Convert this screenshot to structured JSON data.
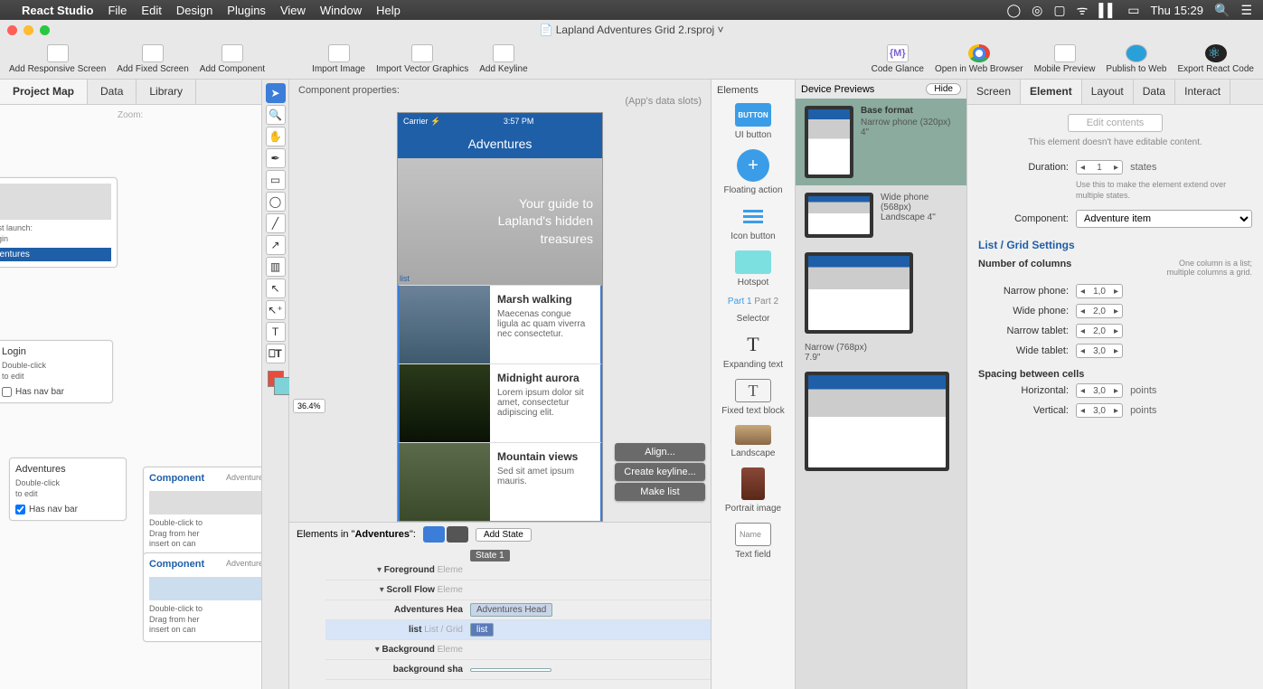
{
  "menubar": {
    "app": "React Studio",
    "items": [
      "File",
      "Edit",
      "Design",
      "Plugins",
      "View",
      "Window",
      "Help"
    ],
    "clock": "Thu 15:29"
  },
  "window": {
    "title": "Lapland Adventures Grid 2.rsproj"
  },
  "toolbar": {
    "left": [
      "Add Responsive Screen",
      "Add Fixed Screen",
      "Add Component"
    ],
    "mid": [
      "Import Image",
      "Import Vector Graphics",
      "Add Keyline"
    ],
    "right": [
      "Code Glance",
      "Open in Web Browser",
      "Mobile Preview",
      "Publish to Web",
      "Export React Code"
    ]
  },
  "left_tabs": [
    "Project Map",
    "Data",
    "Library"
  ],
  "project_map": {
    "zoom_label": "Zoom:",
    "head_card": {
      "first_launch": "First launch:",
      "first_launch_val": "Login",
      "sub": "dventures"
    },
    "login": {
      "title": "Login",
      "sub": "Double-click\nto edit",
      "nav_label": "Has nav bar",
      "nav_checked": false
    },
    "adventures": {
      "title": "Adventures",
      "sub": "Double-click\nto edit",
      "nav_label": "Has nav bar",
      "nav_checked": true
    },
    "comp1": {
      "title": "Component",
      "tag": "Adventure",
      "sub": "Double-click to\nDrag from her\ninsert on can"
    },
    "comp2": {
      "title": "Component",
      "tag": "Adventure",
      "sub": "Double-click to\nDrag from her\ninsert on can"
    }
  },
  "canvas": {
    "props_label": "Component properties:",
    "props_sub": "(App's data slots)",
    "zoom": "36.4%",
    "phone": {
      "carrier": "Carrier ⚡",
      "time": "3:57 PM",
      "navbar": "Adventures",
      "hero_text": "Your guide to Lapland's hidden treasures",
      "hero_label": "list",
      "items": [
        {
          "title": "Marsh walking",
          "body": "Maecenas congue ligula ac quam viverra nec consectetur."
        },
        {
          "title": "Midnight aurora",
          "body": "Lorem ipsum dolor sit amet, consectetur adipiscing elit."
        },
        {
          "title": "Mountain views",
          "body": "Sed sit amet ipsum mauris."
        }
      ]
    },
    "context_menu": [
      "Align...",
      "Create keyline...",
      "Make list"
    ]
  },
  "timeline": {
    "title_prefix": "Elements in \"",
    "title_screen": "Adventures",
    "title_suffix": "\":",
    "add_state": "Add State",
    "state": "State 1",
    "rows": [
      {
        "label": "Foreground",
        "hint": "Eleme"
      },
      {
        "label": "Scroll Flow",
        "hint": "Eleme"
      },
      {
        "label": "Adventures Hea",
        "bar": "Adventures Head"
      },
      {
        "label": "list",
        "hint": "List / Grid",
        "bar": "list"
      },
      {
        "label": "Background",
        "hint": "Eleme"
      },
      {
        "label": "background sha",
        "bar": " "
      }
    ]
  },
  "elements_panel": {
    "heading": "Elements",
    "items": [
      "UI button",
      "Floating action",
      "Icon button",
      "Hotspot",
      "Selector",
      "Expanding text",
      "Fixed text block",
      "Landscape",
      "Portrait image",
      "Text field"
    ],
    "button_badge": "BUTTON",
    "part1": "Part 1",
    "part2": "Part 2",
    "name_placeholder": "Name"
  },
  "previews": {
    "heading": "Device Previews",
    "hide": "Hide",
    "devices": [
      {
        "title": "Base format",
        "sub1": "Narrow phone (320px)",
        "sub2": "4\""
      },
      {
        "title": "",
        "sub1": "Wide phone (568px)",
        "sub2": "Landscape 4\""
      },
      {
        "title": "",
        "sub1": "Narrow (768px)",
        "sub2": "7.9\""
      },
      {
        "title": "",
        "sub1": "",
        "sub2": ""
      }
    ]
  },
  "inspector": {
    "tabs": [
      "Screen",
      "Element",
      "Layout",
      "Data",
      "Interact"
    ],
    "active_tab": "Element",
    "edit_contents": "Edit contents",
    "no_edit_note": "This element doesn't have editable content.",
    "duration_label": "Duration:",
    "duration_val": "1",
    "duration_unit": "states",
    "duration_help": "Use this to make the element extend over multiple states.",
    "component_label": "Component:",
    "component_val": "Adventure item",
    "section": "List / Grid Settings",
    "num_cols_label": "Number of columns",
    "cols_help": "One column is a list;\nmultiple columns a grid.",
    "rows": [
      {
        "label": "Narrow phone:",
        "val": "1,0"
      },
      {
        "label": "Wide phone:",
        "val": "2,0"
      },
      {
        "label": "Narrow tablet:",
        "val": "2,0"
      },
      {
        "label": "Wide tablet:",
        "val": "3,0"
      }
    ],
    "spacing_label": "Spacing between cells",
    "spacing": [
      {
        "label": "Horizontal:",
        "val": "3,0",
        "unit": "points"
      },
      {
        "label": "Vertical:",
        "val": "3,0",
        "unit": "points"
      }
    ]
  }
}
